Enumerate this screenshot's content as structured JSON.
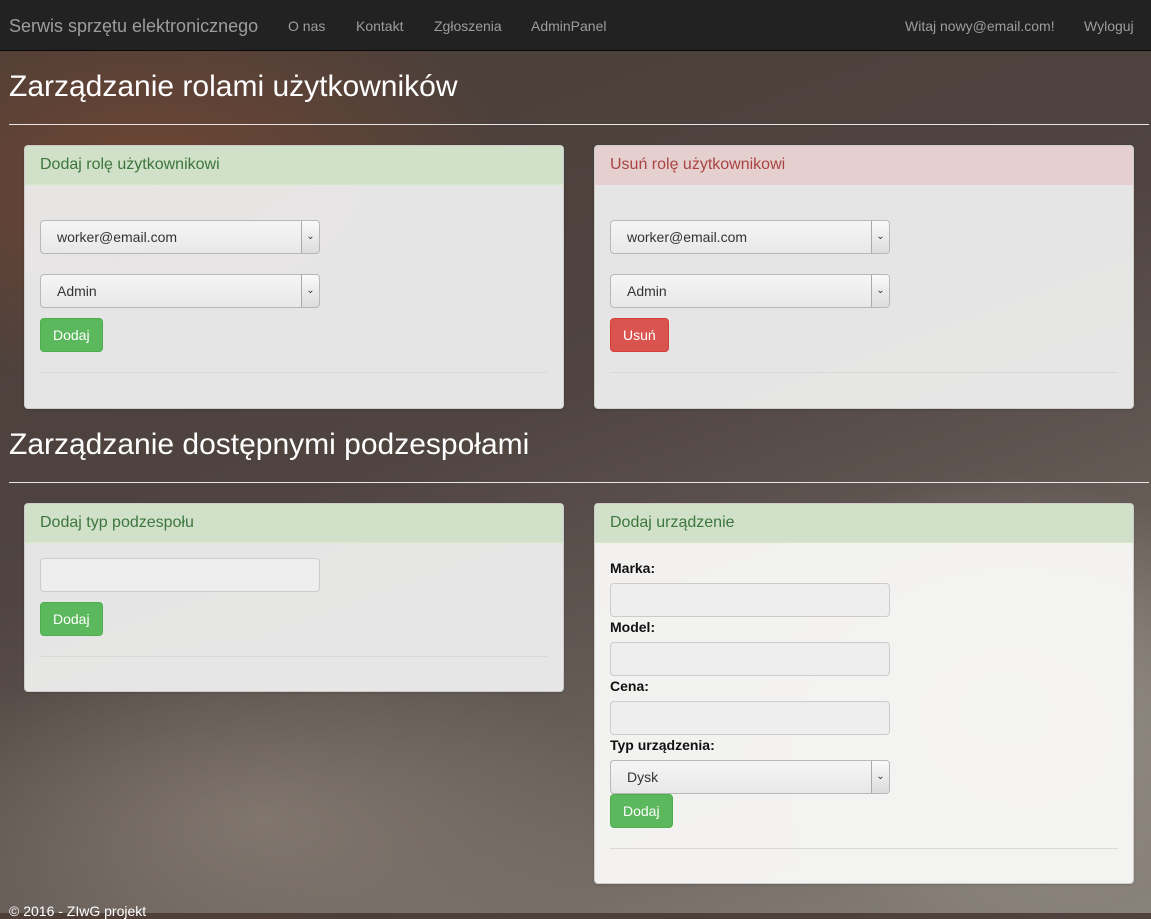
{
  "navbar": {
    "brand": "Serwis sprzętu elektronicznego",
    "links": [
      "O nas",
      "Kontakt",
      "Zgłoszenia",
      "AdminPanel"
    ],
    "greeting": "Witaj nowy@email.com!",
    "logout": "Wyloguj"
  },
  "roles_section": {
    "title": "Zarządzanie rolami użytkowników",
    "add_panel": {
      "heading": "Dodaj rolę użytkownikowi",
      "user_value": "worker@email.com",
      "role_value": "Admin",
      "button": "Dodaj"
    },
    "remove_panel": {
      "heading": "Usuń rolę użytkownikowi",
      "user_value": "worker@email.com",
      "role_value": "Admin",
      "button": "Usuń"
    }
  },
  "components_section": {
    "title": "Zarządzanie dostępnymi podzespołami",
    "component_type_panel": {
      "heading": "Dodaj typ podzespołu",
      "input_value": "",
      "button": "Dodaj"
    },
    "device_panel": {
      "heading": "Dodaj urządzenie",
      "brand_label": "Marka:",
      "model_label": "Model:",
      "price_label": "Cena:",
      "type_label": "Typ urządzenia:",
      "type_value": "Dysk",
      "button": "Dodaj"
    }
  },
  "footer": {
    "text": "© 2016 - ZIwG projekt"
  },
  "colors": {
    "success": "#5cb85c",
    "danger": "#d9534f",
    "navbar": "#222222"
  }
}
